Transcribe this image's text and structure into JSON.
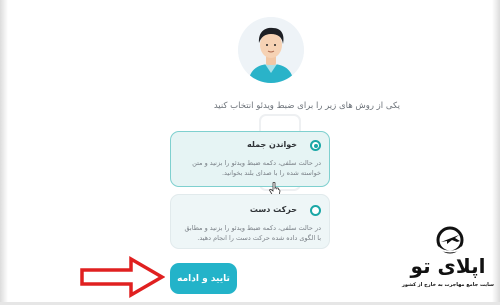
{
  "prompt": {
    "text": "یکی از روش های زیر را برای ضبط ویدئو انتخاب کنید"
  },
  "options": [
    {
      "title": "خواندن جمله",
      "description": "در حالت سلفی، دکمه ضبط ویدئو را بزنید و متن خواسته شده را با صدای بلند بخوانید.",
      "selected": true
    },
    {
      "title": "حرکت دست",
      "description": "در حالت سلفی، دکمه ضبط ویدئو را بزنید و مطابق با الگوی داده شده حرکت دست را انجام دهید.",
      "selected": false
    }
  ],
  "confirm_button": {
    "label": "تایید و ادامه"
  },
  "logo": {
    "name": "اپلای تو",
    "tagline": "سایت جامع مهاجرت به خارج از کشور"
  },
  "colors": {
    "accent": "#1aa7a6",
    "button": "#23b3c9",
    "selected_bg": "#e6f4f4",
    "arrow": "#e02020"
  },
  "icons": {
    "avatar": "user-avatar-icon",
    "arrow": "red-arrow-icon",
    "cursor": "hand-cursor-icon",
    "logo": "plane-logo-icon"
  }
}
